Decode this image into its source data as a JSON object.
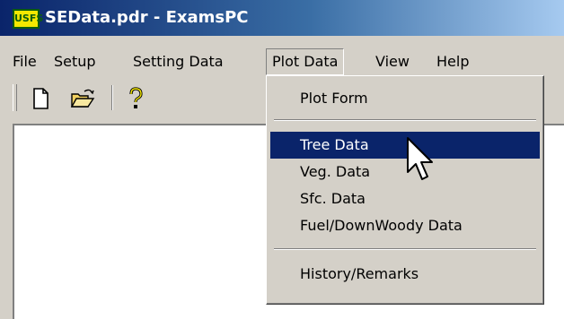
{
  "window": {
    "title": "SEData.pdr - ExamsPC",
    "icon_glyph": "USFS",
    "icon": "app-shield-icon"
  },
  "menubar": {
    "items": [
      {
        "label": "File"
      },
      {
        "label": "Setup"
      },
      {
        "label": "Setting Data"
      },
      {
        "label": "Plot Data"
      },
      {
        "label": "View"
      },
      {
        "label": "Help"
      }
    ],
    "open_index": 3
  },
  "toolbar": {
    "buttons": [
      {
        "icon": "new-document-icon"
      },
      {
        "icon": "open-folder-icon"
      },
      {
        "icon": "help-icon"
      }
    ]
  },
  "dropdown": {
    "items": [
      {
        "label": "Plot Form"
      },
      {
        "label": "Tree Data",
        "highlighted": true
      },
      {
        "label": "Veg. Data"
      },
      {
        "label": "Sfc. Data"
      },
      {
        "label": "Fuel/DownWoody Data"
      },
      {
        "label": "History/Remarks"
      }
    ]
  },
  "colors": {
    "face": "#d4d0c8",
    "highlight": "#0a246a",
    "title_start": "#0a246a",
    "title_end": "#a6caf0"
  }
}
